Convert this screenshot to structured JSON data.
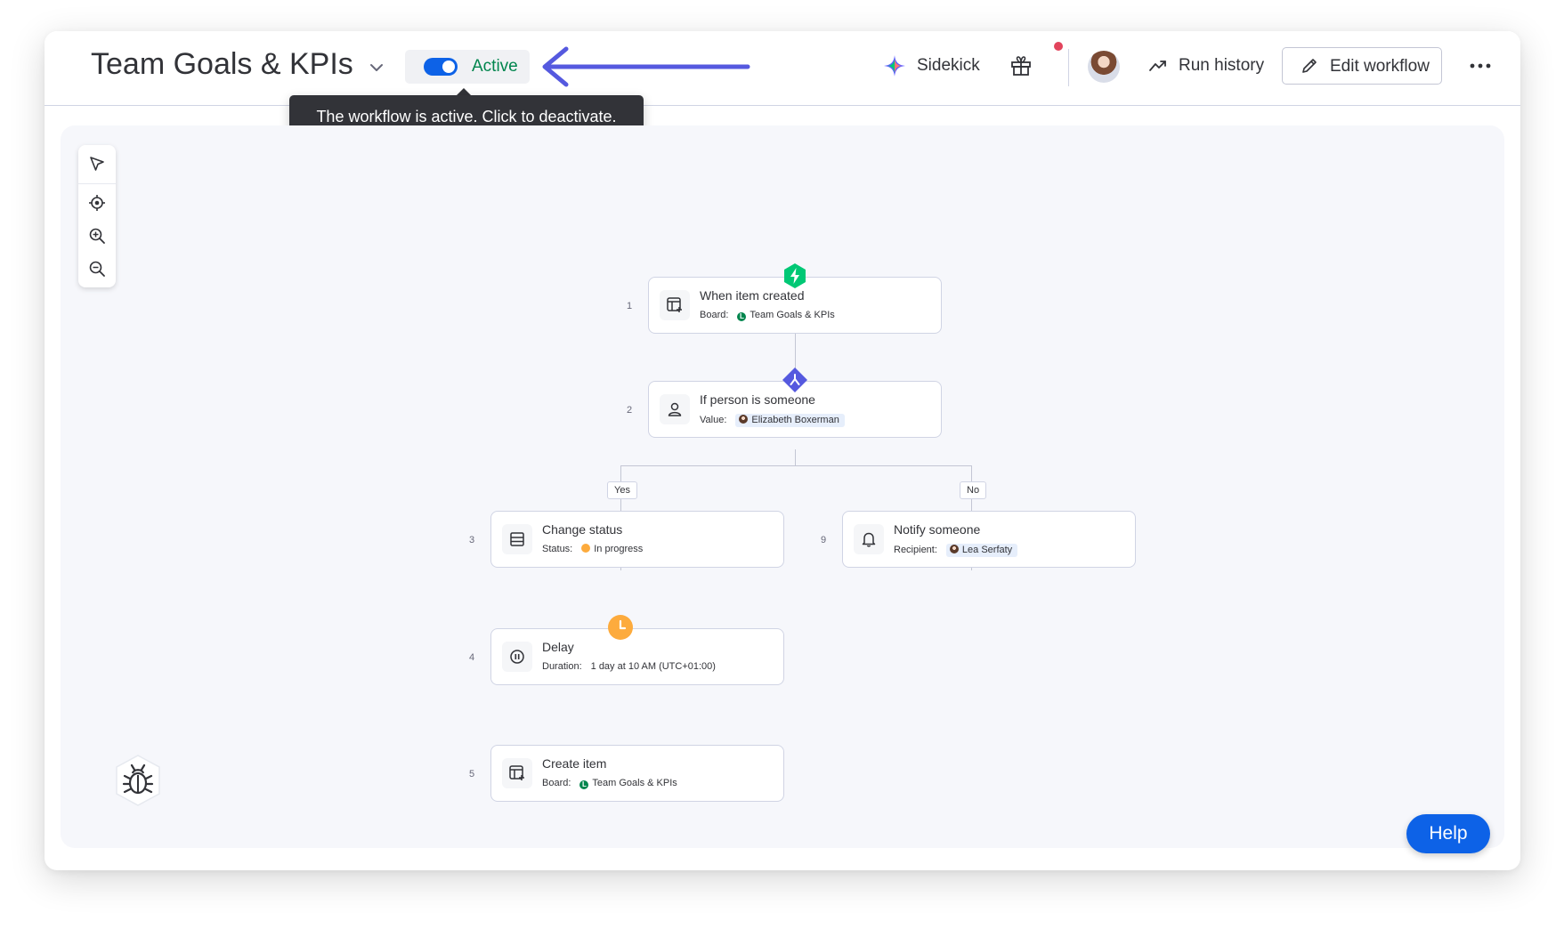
{
  "header": {
    "title": "Team Goals & KPIs",
    "toggle_label": "Active",
    "tooltip": "The workflow is active. Click to deactivate.",
    "sidekick_label": "Sidekick",
    "run_history_label": "Run history",
    "edit_label": "Edit workflow"
  },
  "icons": {
    "title_dropdown": "chevron-down-icon",
    "sidekick": "sparkle-icon",
    "gift": "gift-icon",
    "run_history": "trend-icon",
    "edit": "pencil-icon",
    "more": "more-dots-icon",
    "tools": [
      "cursor-icon",
      "recenter-icon",
      "zoom-in-icon",
      "zoom-out-icon"
    ],
    "debug": "bug-icon"
  },
  "colors": {
    "accent": "#0d62e7",
    "active_green": "#00854d",
    "trigger_badge": "#00c875",
    "condition_badge": "#5559df",
    "delay_badge": "#fdab3d",
    "arrow": "#5559df"
  },
  "workflow": {
    "steps": [
      {
        "num": "1",
        "title": "When item created",
        "field_label": "Board:",
        "field_value": "Team Goals & KPIs"
      },
      {
        "num": "2",
        "title": "If person is someone",
        "field_label": "Value:",
        "field_value": "Elizabeth Boxerman"
      },
      {
        "num": "3",
        "title": "Change status",
        "field_label": "Status:",
        "field_value": "In progress"
      },
      {
        "num": "9",
        "title": "Notify someone",
        "field_label": "Recipient:",
        "field_value": "Lea Serfaty"
      },
      {
        "num": "4",
        "title": "Delay",
        "field_label": "Duration:",
        "field_value": "1 day at 10 AM (UTC+01:00)"
      },
      {
        "num": "5",
        "title": "Create item",
        "field_label": "Board:",
        "field_value": "Team Goals & KPIs"
      }
    ],
    "branches": {
      "yes": "Yes",
      "no": "No"
    },
    "board_initial": "L"
  },
  "help_label": "Help"
}
